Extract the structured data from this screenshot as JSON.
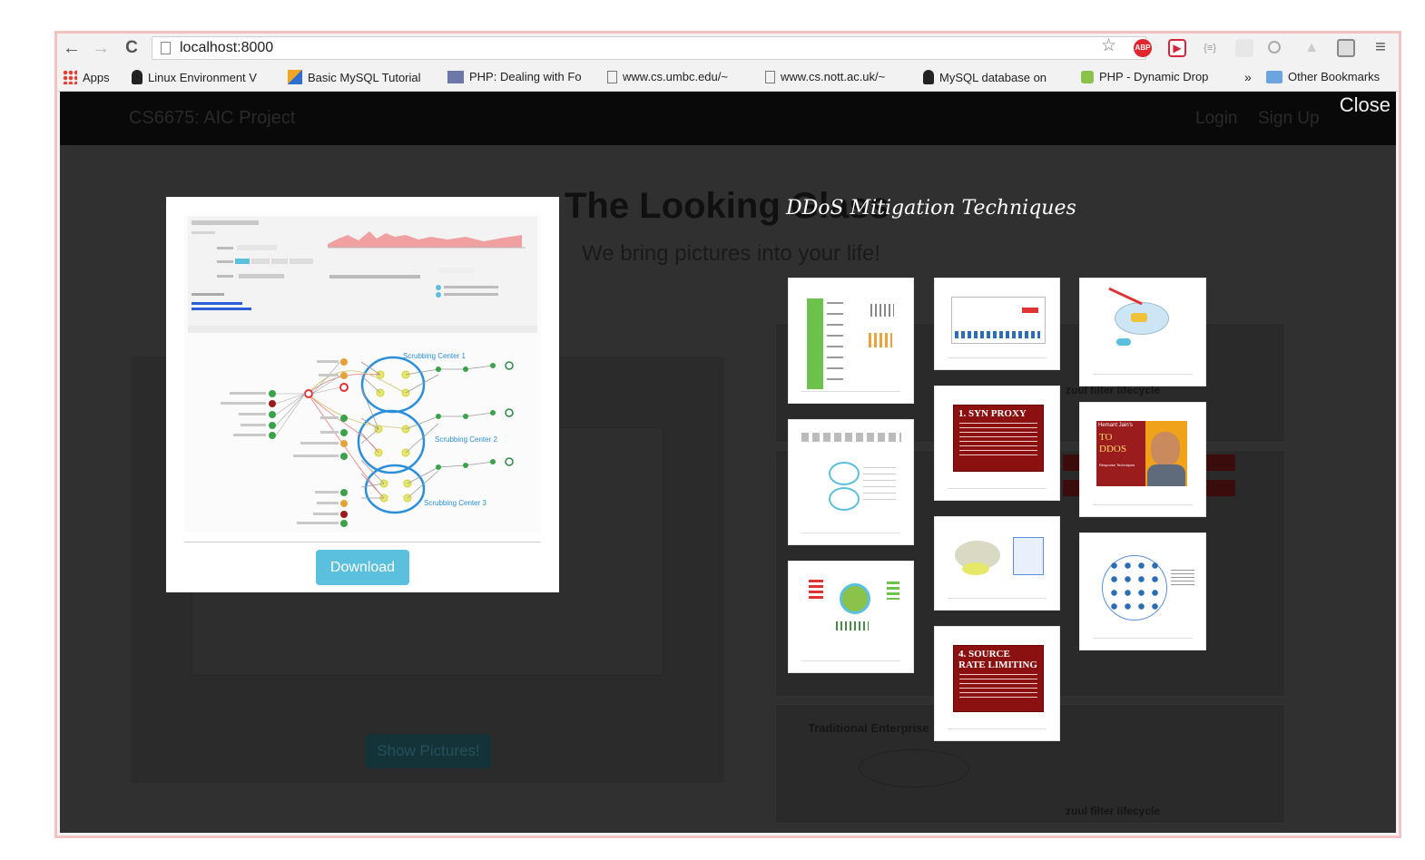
{
  "browser": {
    "url": "localhost:8000",
    "nav": {
      "back": "←",
      "forward": "→",
      "reload": "C"
    },
    "extensions": [
      "star-icon",
      "abp-icon",
      "ext-red-icon",
      "json-icon",
      "ext-grey-icon",
      "search-ext-icon",
      "ext-drive-icon",
      "ext-window-icon",
      "menu-icon"
    ],
    "abp_label": "ABP",
    "json_label": "{≡}",
    "bookmarks": [
      {
        "label": "Apps",
        "icon": "apps-icon"
      },
      {
        "label": "Linux Environment V",
        "icon": "linux-icon"
      },
      {
        "label": "Basic MySQL Tutorial",
        "icon": "mysql-tutorial-icon"
      },
      {
        "label": "PHP: Dealing with Fo",
        "icon": "php-icon"
      },
      {
        "label": "www.cs.umbc.edu/~",
        "icon": "page-icon"
      },
      {
        "label": "www.cs.nott.ac.uk/~",
        "icon": "page-icon"
      },
      {
        "label": "MySQL database on",
        "icon": "linux-icon"
      },
      {
        "label": "PHP - Dynamic Drop",
        "icon": "puzzle-icon"
      }
    ],
    "more_label": "»",
    "other_bookmarks": "Other Bookmarks"
  },
  "site": {
    "brand": "CS6675: AIC Project",
    "login": "Login",
    "signup": "Sign Up",
    "hero_title": "The Looking Glass",
    "hero_subtitle": "We bring pictures into your life!",
    "show_button": "Show Pictures!",
    "labels": [
      "Traditional Enterprise",
      "zuul filter lifecycle",
      "zuul filter lifecycle"
    ]
  },
  "overlay": {
    "close_label": "Close",
    "download_label": "Download",
    "gallery_title": "DDoS Mitigation Techniques",
    "preview": {
      "centers": [
        "Scrubbing Center 1",
        "Scrubbing Center 2",
        "Scrubbing Center 3"
      ]
    },
    "slides": {
      "syn": "1. SYN PROXY",
      "rate": "4. SOURCE RATE LIMITING",
      "jain_top": "Hemant Jain's",
      "jain_main": "TO DDOS",
      "jain_sub": "Response Techniques"
    }
  },
  "colors": {
    "accent": "#5bc0de",
    "slide_red": "#8b1111",
    "scrubbing_blue": "#2b8fd9"
  }
}
